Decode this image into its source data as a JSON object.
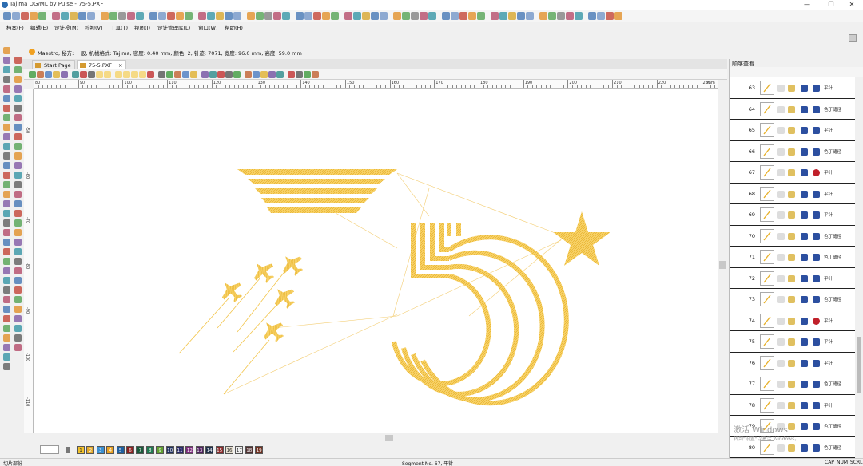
{
  "app": {
    "title": "Tajima DG/ML by Pulse - 75-5.PXF",
    "minimize_glyph": "—",
    "restore_glyph": "❐",
    "close_glyph": "✕"
  },
  "menu": [
    "档案(F)",
    "编辑(E)",
    "设计投(M)",
    "检视(V)",
    "工具(T)",
    "视图(I)",
    "设计管理库(L)",
    "窗口(W)",
    "帮助(H)"
  ],
  "info_bar": {
    "text": "Maestro, 秘方: 一般, 机械格式: Tajima, 密度: 0.40 mm, 颜色: 2, 针迹: 7071, 宽度: 96.0 mm, 高度: 59.0 mm"
  },
  "tabs": [
    {
      "label": "Start Page",
      "active": false
    },
    {
      "label": "75-5.PXF",
      "active": true,
      "close": "×"
    }
  ],
  "ruler": {
    "horizontal": [
      "80",
      "90",
      "100",
      "110",
      "120",
      "130",
      "140",
      "150",
      "160",
      "170",
      "180",
      "190",
      "200",
      "210",
      "220",
      "230",
      "mm"
    ],
    "vertical": [
      "-50",
      "-60",
      "-70",
      "-80",
      "-90",
      "-100",
      "-110"
    ]
  },
  "color_bar": {
    "numbers": [
      "1",
      "2",
      "3",
      "4",
      "5",
      "6",
      "7",
      "8",
      "9",
      "10",
      "11",
      "12",
      "13",
      "14",
      "15",
      "16",
      "17",
      "18",
      "19"
    ],
    "colors": [
      "#f2c22a",
      "#e3a92a",
      "#3a8fd1",
      "#e8a020",
      "#2060a0",
      "#8a2020",
      "#1a5a3a",
      "#207a50",
      "#60a030",
      "#203060",
      "#2a2a6a",
      "#7a2a7a",
      "#502060",
      "#20304a",
      "#8a2a2a",
      "#e8e0d0",
      "#f0f0f0",
      "#503030",
      "#703020"
    ]
  },
  "status": {
    "left": "切片部份",
    "center": "Segment No. 67, 平针",
    "right": [
      "CAP",
      "NUM",
      "SCRL"
    ]
  },
  "panel": {
    "title": "顺序查看",
    "rows": [
      {
        "num": "63",
        "type": "平针",
        "stop": false
      },
      {
        "num": "64",
        "type": "色丁缝径",
        "stop": false
      },
      {
        "num": "65",
        "type": "平针",
        "stop": false
      },
      {
        "num": "66",
        "type": "色丁缝径",
        "stop": false
      },
      {
        "num": "67",
        "type": "平针",
        "stop": true
      },
      {
        "num": "68",
        "type": "平针",
        "stop": false
      },
      {
        "num": "69",
        "type": "平针",
        "stop": false
      },
      {
        "num": "70",
        "type": "色丁缝径",
        "stop": false
      },
      {
        "num": "71",
        "type": "色丁缝径",
        "stop": false
      },
      {
        "num": "72",
        "type": "平针",
        "stop": false
      },
      {
        "num": "73",
        "type": "色丁缝径",
        "stop": false
      },
      {
        "num": "74",
        "type": "平针",
        "stop": true
      },
      {
        "num": "75",
        "type": "平针",
        "stop": false
      },
      {
        "num": "76",
        "type": "平针",
        "stop": false
      },
      {
        "num": "77",
        "type": "色丁缝径",
        "stop": false
      },
      {
        "num": "78",
        "type": "平针",
        "stop": false
      },
      {
        "num": "79",
        "type": "色丁缝径",
        "stop": false
      },
      {
        "num": "80",
        "type": "色丁缝径",
        "stop": false
      }
    ]
  },
  "watermark": {
    "line1": "激活 Windows",
    "line2": "转到\"设置\"以激活 Windows。"
  },
  "colors": {
    "stitch": "#f5c542",
    "stitch_dark": "#e8b12a",
    "accent": "#1e73c8"
  }
}
